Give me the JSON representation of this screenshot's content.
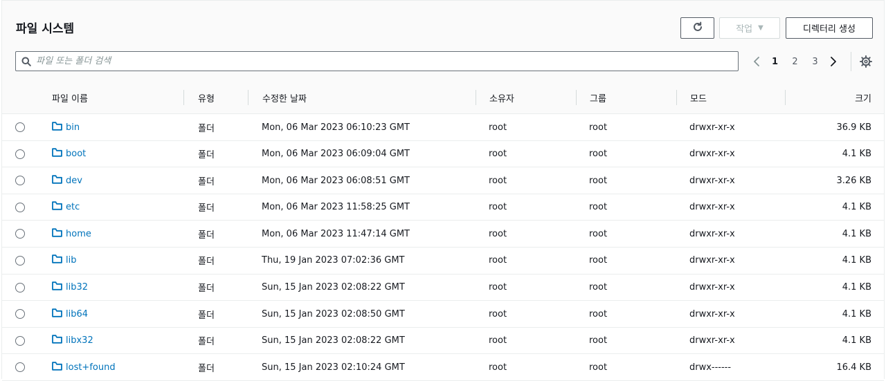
{
  "header": {
    "title": "파일 시스템",
    "actions_label": "작업",
    "create_label": "디렉터리 생성"
  },
  "search": {
    "placeholder": "파일 또는 폴더 검색",
    "value": ""
  },
  "pagination": {
    "pages": [
      "1",
      "2",
      "3"
    ],
    "current": "1"
  },
  "columns": {
    "name": "파일 이름",
    "type": "유형",
    "modified": "수정한 날짜",
    "owner": "소유자",
    "group": "그룹",
    "mode": "모드",
    "size": "크기"
  },
  "rows": [
    {
      "name": "bin",
      "type": "폴더",
      "modified": "Mon, 06 Mar 2023 06:10:23 GMT",
      "owner": "root",
      "group": "root",
      "mode": "drwxr-xr-x",
      "size": "36.9 KB"
    },
    {
      "name": "boot",
      "type": "폴더",
      "modified": "Mon, 06 Mar 2023 06:09:04 GMT",
      "owner": "root",
      "group": "root",
      "mode": "drwxr-xr-x",
      "size": "4.1 KB"
    },
    {
      "name": "dev",
      "type": "폴더",
      "modified": "Mon, 06 Mar 2023 06:08:51 GMT",
      "owner": "root",
      "group": "root",
      "mode": "drwxr-xr-x",
      "size": "3.26 KB"
    },
    {
      "name": "etc",
      "type": "폴더",
      "modified": "Mon, 06 Mar 2023 11:58:25 GMT",
      "owner": "root",
      "group": "root",
      "mode": "drwxr-xr-x",
      "size": "4.1 KB"
    },
    {
      "name": "home",
      "type": "폴더",
      "modified": "Mon, 06 Mar 2023 11:47:14 GMT",
      "owner": "root",
      "group": "root",
      "mode": "drwxr-xr-x",
      "size": "4.1 KB"
    },
    {
      "name": "lib",
      "type": "폴더",
      "modified": "Thu, 19 Jan 2023 07:02:36 GMT",
      "owner": "root",
      "group": "root",
      "mode": "drwxr-xr-x",
      "size": "4.1 KB"
    },
    {
      "name": "lib32",
      "type": "폴더",
      "modified": "Sun, 15 Jan 2023 02:08:22 GMT",
      "owner": "root",
      "group": "root",
      "mode": "drwxr-xr-x",
      "size": "4.1 KB"
    },
    {
      "name": "lib64",
      "type": "폴더",
      "modified": "Sun, 15 Jan 2023 02:08:50 GMT",
      "owner": "root",
      "group": "root",
      "mode": "drwxr-xr-x",
      "size": "4.1 KB"
    },
    {
      "name": "libx32",
      "type": "폴더",
      "modified": "Sun, 15 Jan 2023 02:08:22 GMT",
      "owner": "root",
      "group": "root",
      "mode": "drwxr-xr-x",
      "size": "4.1 KB"
    },
    {
      "name": "lost+found",
      "type": "폴더",
      "modified": "Sun, 15 Jan 2023 02:10:24 GMT",
      "owner": "root",
      "group": "root",
      "mode": "drwx------",
      "size": "16.4 KB"
    }
  ],
  "icons": {
    "refresh": "refresh-icon",
    "search": "search-icon",
    "prev": "chevron-left-icon",
    "next": "chevron-right-icon",
    "settings": "gear-icon",
    "folder": "folder-icon"
  },
  "colors": {
    "link": "#0073bb",
    "border": "#545b64",
    "disabled": "#aab7b8"
  }
}
